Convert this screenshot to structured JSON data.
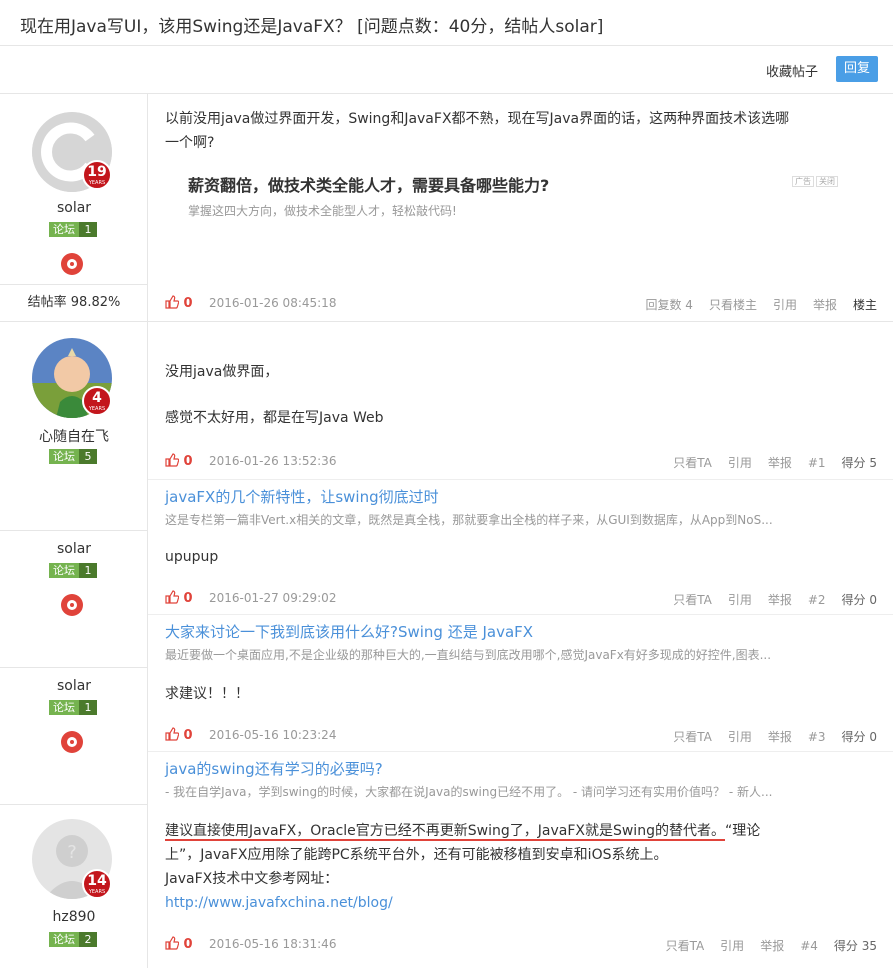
{
  "title": "现在用Java写UI，该用Swing还是JavaFX？ [问题点数：40分，结帖人solar]",
  "actions": {
    "favorite": "收藏帖子",
    "reply": "回复"
  },
  "posts": [
    {
      "user": {
        "name": "solar",
        "years": "19",
        "years_label": "YEARS",
        "badge": "论坛",
        "level": "1",
        "rate": "结帖率 98.82%"
      },
      "content": [
        "以前没用java做过界面开发，Swing和JavaFX都不熟，现在写Java界面的话，这两种界面技术该选哪",
        "一个啊?"
      ],
      "ad": {
        "title": "薪资翻倍，做技术类全能人才，需要具备哪些能力?",
        "desc": "掌握这四大方向，做技术全能型人才，轻松敲代码!",
        "tag1": "广告",
        "tag2": "关闭"
      },
      "likes": "0",
      "time": "2016-01-26 08:45:18",
      "ops": {
        "replies": "回复数 4",
        "only": "只看楼主",
        "quote": "引用",
        "report": "举报",
        "floor": "楼主"
      }
    },
    {
      "user": {
        "name": "心随自在飞",
        "years": "4",
        "years_label": "YEARS",
        "badge": "论坛",
        "level": "5"
      },
      "content": [
        "没用java做界面，",
        "感觉不太好用，都是在写Java Web"
      ],
      "likes": "0",
      "time": "2016-01-26 13:52:36",
      "ops": {
        "only": "只看TA",
        "quote": "引用",
        "report": "举报",
        "floor": "#1",
        "score": "得分 5"
      },
      "related": {
        "title": "javaFX的几个新特性，让swing彻底过时",
        "desc": "这是专栏第一篇非Vert.x相关的文章，既然是真全栈，那就要拿出全栈的样子来，从GUI到数据库，从App到NoS..."
      }
    },
    {
      "user": {
        "name": "solar",
        "badge": "论坛",
        "level": "1"
      },
      "content": [
        "upupup"
      ],
      "likes": "0",
      "time": "2016-01-27 09:29:02",
      "ops": {
        "only": "只看TA",
        "quote": "引用",
        "report": "举报",
        "floor": "#2",
        "score": "得分 0"
      },
      "related": {
        "title": "大家来讨论一下我到底该用什么好?Swing 还是 JavaFX",
        "desc": "最近要做一个桌面应用,不是企业级的那种巨大的,一直纠结与到底改用哪个,感觉JavaFx有好多现成的好控件,图表..."
      }
    },
    {
      "user": {
        "name": "solar",
        "badge": "论坛",
        "level": "1"
      },
      "content": [
        "求建议！！！"
      ],
      "likes": "0",
      "time": "2016-05-16 10:23:24",
      "ops": {
        "only": "只看TA",
        "quote": "引用",
        "report": "举报",
        "floor": "#3",
        "score": "得分 0"
      },
      "related": {
        "title": "java的swing还有学习的必要吗?",
        "desc": "- 我在自学Java，学到swing的时候，大家都在说Java的swing已经不用了。 - 请问学习还有实用价值吗？ - 新人..."
      }
    },
    {
      "user": {
        "name": "hz890",
        "years": "14",
        "years_label": "YEARS",
        "badge": "论坛",
        "level": "2"
      },
      "content": [
        "建议直接使用JavaFX，Oracle官方已经不再更新Swing了，JavaFX就是Swing的替代者。",
        "“理论",
        "上”，JavaFX应用除了能跨PC系统平台外，还有可能被移植到安卓和iOS系统上。",
        "JavaFX技术中文参考网址：",
        "http://www.javafxchina.net/blog/"
      ],
      "likes": "0",
      "time": "2016-05-16 18:31:46",
      "ops": {
        "only": "只看TA",
        "quote": "引用",
        "report": "举报",
        "floor": "#4",
        "score": "得分 35"
      }
    }
  ]
}
